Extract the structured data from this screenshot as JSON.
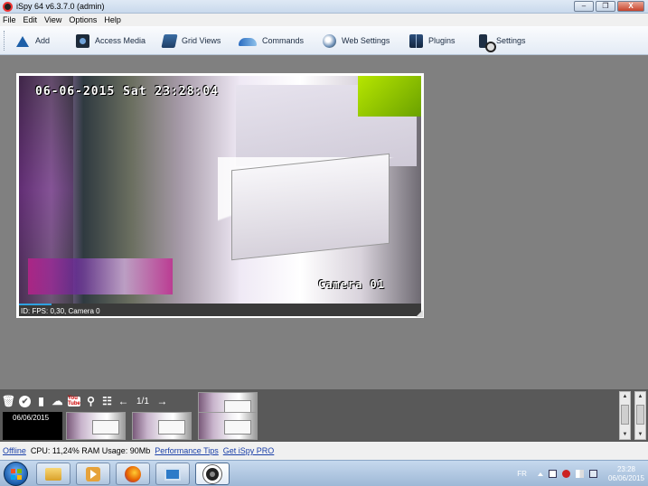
{
  "window": {
    "title": "iSpy 64 v6.3.7.0 (admin)",
    "buttons": [
      "–",
      "❐",
      "X"
    ]
  },
  "menu": [
    "File",
    "Edit",
    "View",
    "Options",
    "Help"
  ],
  "toolbar": {
    "add": "Add",
    "access_media": "Access Media",
    "grid_views": "Grid Views",
    "commands": "Commands",
    "web_settings": "Web Settings",
    "plugins": "Plugins",
    "settings": "Settings"
  },
  "camera": {
    "osd_datetime": "06-06-2015 Sat 23:28:04",
    "osd_label": "Camera 01",
    "status_text": "ID: FPS: 0,30, Camera 0",
    "progress": 0.08
  },
  "strip": {
    "page_indicator": "1/1",
    "selected_date": "06/06/2015",
    "tool_icons": [
      "trash-icon",
      "check-icon",
      "book-icon",
      "cloud-upload-icon",
      "youtube-icon",
      "magnifier-icon",
      "network-icon",
      "arrow-left-icon",
      "arrow-right-icon"
    ],
    "youtube_label": "You Tube"
  },
  "statusbar": {
    "offline": "Offline",
    "cpu_ram": "CPU: 11,24% RAM Usage: 90Mb",
    "performance_tips": "Performance Tips",
    "get_pro": "Get iSpy PRO"
  },
  "taskbar": {
    "language": "FR",
    "time": "23:28",
    "date": "06/06/2015"
  },
  "colors": {
    "workspace": "#808080",
    "strip": "#595959",
    "progress": "#2ea1e0",
    "link": "#1a3fa8"
  }
}
